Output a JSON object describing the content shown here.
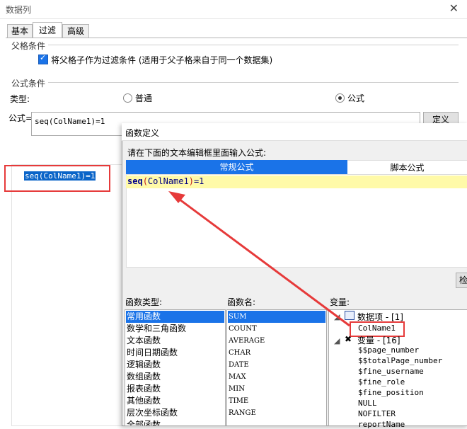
{
  "window": {
    "title": "数据列",
    "close_glyph": "✕"
  },
  "tabs": [
    {
      "label": "基本"
    },
    {
      "label": "过滤"
    },
    {
      "label": "高级"
    }
  ],
  "parent_condition": {
    "group_label": "父格条件",
    "checkbox_label": "将父格子作为过滤条件 (适用于父子格来自于同一个数据集)",
    "checked": true
  },
  "formula_condition": {
    "group_label": "公式条件",
    "type_label": "类型:",
    "radio_normal": "普通",
    "radio_formula": "公式",
    "selected": "公式",
    "formula_label": "公式=",
    "formula_value": "seq(ColName1)=1",
    "define_button": "定义"
  },
  "preview": {
    "selected_text": "seq(ColName1)=1"
  },
  "dialog": {
    "title": "函数定义",
    "prompt": "请在下面的文本编辑框里面输入公式:",
    "tab_regular": "常规公式",
    "tab_script": "脚本公式",
    "editor": {
      "fn": "seq",
      "lp": "(",
      "arg": "ColName1",
      "rp": ")",
      "rest": "=1"
    },
    "check_button": "检",
    "function_types_label": "函数类型:",
    "function_types": [
      "常用函数",
      "数学和三角函数",
      "文本函数",
      "时间日期函数",
      "逻辑函数",
      "数组函数",
      "报表函数",
      "其他函数",
      "层次坐标函数",
      "全部函数"
    ],
    "function_names_label": "函数名:",
    "function_names": [
      "SUM",
      "COUNT",
      "AVERAGE",
      "CHAR",
      "DATE",
      "MAX",
      "MIN",
      "TIME",
      "RANGE"
    ],
    "variables_label": "变量:",
    "variables": {
      "data_items": "数据项 - [1]",
      "data_item_0": "ColName1",
      "vars": "变量 - [16]",
      "var_items": [
        "$$page_number",
        "$$totalPage_number",
        "$fine_username",
        "$fine_role",
        "$fine_position",
        "NULL",
        "NOFILTER",
        "reportName"
      ]
    }
  },
  "colors": {
    "accent": "#1a73e8",
    "highlight_red": "#e63a3a",
    "editor_line": "#fffaa8"
  }
}
